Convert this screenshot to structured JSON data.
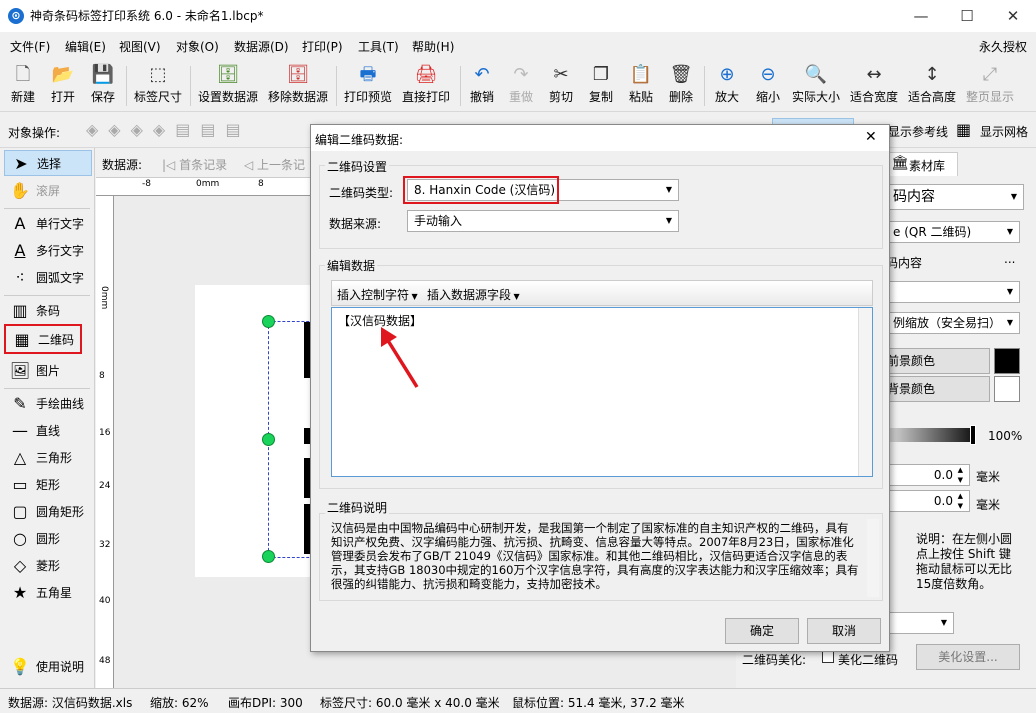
{
  "window": {
    "title": "神奇条码标签打印系统 6.0 - 未命名1.lbcp*",
    "minimize": "—",
    "maximize": "☐",
    "close": "✕"
  },
  "menu": [
    "文件(F)",
    "编辑(E)",
    "视图(V)",
    "对象(O)",
    "数据源(D)",
    "打印(P)",
    "工具(T)",
    "帮助(H)"
  ],
  "license": "永久授权",
  "toolbar": [
    {
      "label": "新建",
      "icon": "new-doc-icon",
      "glyph": "🗋"
    },
    {
      "label": "打开",
      "icon": "open-icon",
      "glyph": "📂"
    },
    {
      "label": "保存",
      "icon": "save-icon",
      "glyph": "💾"
    },
    {
      "label": "标签尺寸",
      "icon": "label-size-icon",
      "glyph": "⬚"
    },
    {
      "label": "设置数据源",
      "icon": "database-icon",
      "glyph": "🗄"
    },
    {
      "label": "移除数据源",
      "icon": "database-remove-icon",
      "glyph": "🗄"
    },
    {
      "label": "打印预览",
      "icon": "print-preview-icon",
      "glyph": "🖶"
    },
    {
      "label": "直接打印",
      "icon": "printer-icon",
      "glyph": "🖨"
    },
    {
      "label": "撤销",
      "icon": "undo-icon",
      "glyph": "↶"
    },
    {
      "label": "重做",
      "icon": "redo-icon",
      "glyph": "↷"
    },
    {
      "label": "剪切",
      "icon": "cut-icon",
      "glyph": "✂"
    },
    {
      "label": "复制",
      "icon": "copy-icon",
      "glyph": "❐"
    },
    {
      "label": "粘贴",
      "icon": "paste-icon",
      "glyph": "📋"
    },
    {
      "label": "删除",
      "icon": "trash-icon",
      "glyph": "🗑"
    },
    {
      "label": "放大",
      "icon": "zoom-in-icon",
      "glyph": "⊕"
    },
    {
      "label": "缩小",
      "icon": "zoom-out-icon",
      "glyph": "⊖"
    },
    {
      "label": "实际大小",
      "icon": "actual-size-icon",
      "glyph": "🔍"
    },
    {
      "label": "适合宽度",
      "icon": "fit-width-icon",
      "glyph": "↔"
    },
    {
      "label": "适合高度",
      "icon": "fit-height-icon",
      "glyph": "↕"
    },
    {
      "label": "整页显示",
      "icon": "fit-page-icon",
      "glyph": "⤢"
    }
  ],
  "objbar": {
    "label": "对象操作:",
    "show_ref_lines": "显示参考线",
    "show_grid": "显示网格"
  },
  "tools": [
    {
      "label": "选择",
      "icon": "pointer-icon",
      "glyph": "➤"
    },
    {
      "label": "滚屏",
      "icon": "hand-icon",
      "glyph": "✋"
    },
    {
      "label": "单行文字",
      "icon": "text-icon",
      "glyph": "A"
    },
    {
      "label": "多行文字",
      "icon": "multiline-text-icon",
      "glyph": "A"
    },
    {
      "label": "圆弧文字",
      "icon": "arc-text-icon",
      "glyph": "⁖"
    },
    {
      "label": "条码",
      "icon": "barcode-icon",
      "glyph": "▥"
    },
    {
      "label": "二维码",
      "icon": "qrcode-icon",
      "glyph": "▦"
    },
    {
      "label": "图片",
      "icon": "image-icon",
      "glyph": "🖼"
    },
    {
      "label": "手绘曲线",
      "icon": "pen-icon",
      "glyph": "✎"
    },
    {
      "label": "直线",
      "icon": "line-icon",
      "glyph": "—"
    },
    {
      "label": "三角形",
      "icon": "triangle-icon",
      "glyph": "△"
    },
    {
      "label": "矩形",
      "icon": "rectangle-icon",
      "glyph": "▭"
    },
    {
      "label": "圆角矩形",
      "icon": "rounded-rect-icon",
      "glyph": "▢"
    },
    {
      "label": "圆形",
      "icon": "circle-icon",
      "glyph": "○"
    },
    {
      "label": "菱形",
      "icon": "diamond-icon",
      "glyph": "◇"
    },
    {
      "label": "五角星",
      "icon": "star-icon",
      "glyph": "★"
    }
  ],
  "help": {
    "label": "使用说明",
    "icon": "lightbulb-icon",
    "glyph": "💡"
  },
  "datasource_bar": {
    "label": "数据源:",
    "first": "首条记录",
    "prev": "上一条记"
  },
  "ruler": {
    "h": [
      "-8",
      "0mm",
      "8"
    ],
    "v": [
      "0mm",
      "8",
      "16",
      "24",
      "32",
      "40",
      "48"
    ]
  },
  "right": {
    "tab": "素材库",
    "content_combo": "码内容",
    "type_combo": "e (QR 二维码)",
    "content_label": "码内容",
    "ellipsis": "...",
    "scale_combo": "例缩放（安全易扫）",
    "fg_btn": "前景颜色",
    "bg_btn": "背景颜色",
    "opacity": "100%",
    "val1": "0.0",
    "val2": "0.0",
    "unit": "毫米",
    "hint": "说明：在左侧小圆点上按住 Shift 键拖动鼠标可以无比15度倍数角。",
    "beautify_label": "二维码美化:",
    "beautify_check": "美化二维码",
    "beautify_btn": "美化设置..."
  },
  "status": {
    "datasource": "数据源: 汉信码数据.xls",
    "zoom": "缩放: 62%",
    "dpi": "画布DPI: 300",
    "size": "标签尺寸: 60.0 毫米 x 40.0 毫米",
    "mouse": "鼠标位置: 51.4 毫米, 37.2 毫米"
  },
  "dialog": {
    "title": "编辑二维码数据:",
    "close": "✕",
    "settings_group": "二维码设置",
    "type_label": "二维码类型:",
    "type_value": "8. Hanxin Code (汉信码)",
    "source_label": "数据来源:",
    "source_value": "手动输入",
    "edit_group": "编辑数据",
    "insert_ctrl": "插入控制字符",
    "insert_field": "插入数据源字段",
    "data_text": "【汉信码数据】",
    "desc_group": "二维码说明",
    "desc_text": "汉信码是由中国物品编码中心研制开发，是我国第一个制定了国家标准的自主知识产权的二维码，具有知识产权免费、汉字编码能力强、抗污损、抗畸变、信息容量大等特点。2007年8月23日，国家标准化管理委员会发布了GB/T 21049《汉信码》国家标准。和其他二维码相比，汉信码更适合汉字信息的表示，其支持GB 18030中规定的160万个汉字信息字符，具有高度的汉字表达能力和汉字压缩效率；具有很强的纠错能力、抗污损和畸变能力，支持加密技术。",
    "ok": "确定",
    "cancel": "取消"
  },
  "colors": {
    "highlight": "#e0161e",
    "handle": "#19d35a",
    "arrow": "#e0161e",
    "accent": "#1a6fd1"
  }
}
